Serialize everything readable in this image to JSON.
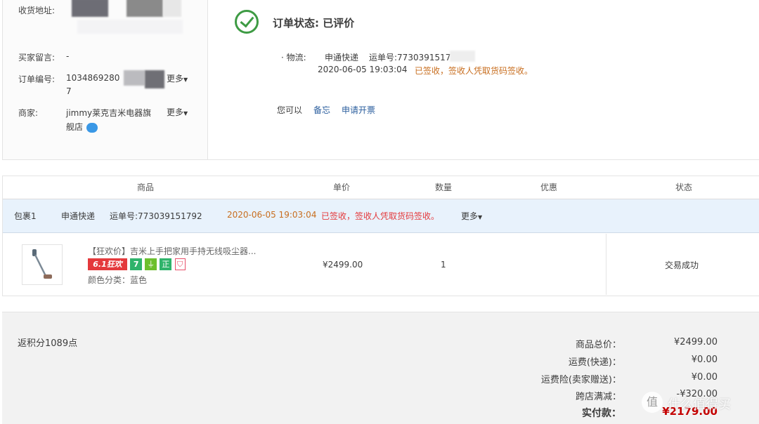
{
  "info": {
    "address_label": "收货地址:",
    "message_label": "买家留言:",
    "message_value": "-",
    "order_no_label": "订单编号:",
    "order_no_value": "1034869280",
    "order_no_tail": "7",
    "more_label": "更多",
    "seller_label": "商家:",
    "seller_name_line1": "jimmy莱克吉米电器旗",
    "seller_name_line2": "舰店"
  },
  "status": {
    "title": "订单状态: 已评价",
    "logistics_label": "· 物流:",
    "carrier": "申通快递",
    "waybill": "运单号:7730391517",
    "time": "2020-06-05 19:03:04",
    "sign_text": "已签收，签收人凭取货码签收。",
    "actions_label": "您可以",
    "action_memo": "备忘",
    "action_invoice": "申请开票"
  },
  "table": {
    "headers": [
      "商品",
      "单价",
      "数量",
      "优惠",
      "状态"
    ],
    "package": {
      "name": "包裹1",
      "carrier": "申通快递",
      "waybill": "运单号:773039151792",
      "time": "2020-06-05 19:03:04",
      "sign_text": "已签收，签收人凭取货码签收。",
      "more": "更多"
    },
    "item": {
      "title": "【狂欢价】吉米上手把家用手持无线吸尘器...",
      "badge_sale": "6.1狂欢",
      "badge_seven": "7",
      "badge_genuine": "正",
      "attr": "颜色分类：蓝色",
      "price": "¥2499.00",
      "qty": "1",
      "status": "交易成功"
    }
  },
  "summary": {
    "points": "返积分1089点",
    "rows": [
      {
        "label": "商品总价：",
        "value": "¥2499.00"
      },
      {
        "label": "运费(快递)：",
        "value": "¥0.00"
      },
      {
        "label": "运费险(卖家赠送)：",
        "value": "¥0.00"
      },
      {
        "label": "跨店满减：",
        "value": "-¥320.00"
      }
    ],
    "paid_label": "实付款：",
    "paid_value": "¥2179.00"
  },
  "watermark": {
    "text": "值 什么值得买"
  },
  "colors": {
    "check_green": "#3e9b44",
    "sign_orange": "#c86e1f",
    "link_blue": "#2c5f9e",
    "paid_red": "#c40000",
    "badge_red": "#e4393c",
    "badge_green": "#2fb36b",
    "badge_lime": "#6cbf2e",
    "badge_pink": "#e8506a"
  }
}
